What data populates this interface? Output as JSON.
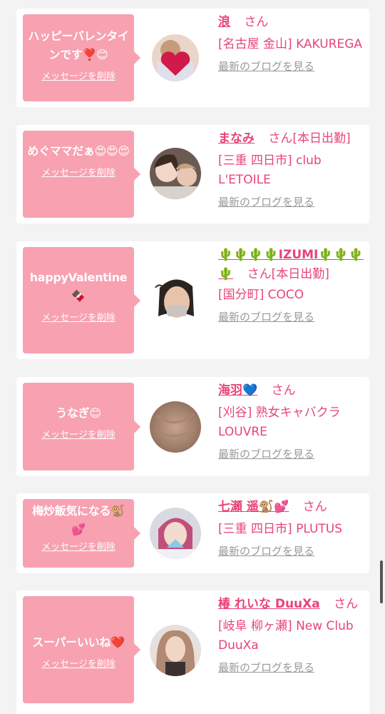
{
  "items": [
    {
      "message": "ハッピーバレンタインです❣️😊",
      "delete_label": "メッセージを削除",
      "name": "浪",
      "suffix": "さん",
      "location": "[名古屋 金山] KAKUREGA",
      "blog_label": "最新のブログを見る"
    },
    {
      "message": "めぐママだぁ😍😍😍",
      "delete_label": "メッセージを削除",
      "name": "まなみ",
      "suffix": "さん[本日出勤]",
      "location": "[三重 四日市] club L'ETOILE",
      "blog_label": "最新のブログを見る"
    },
    {
      "message": "happyValentine🍫",
      "delete_label": "メッセージを削除",
      "name": "🌵🌵🌵🌵IZUMI🌵🌵🌵🌵",
      "suffix": "さん[本日出勤]",
      "location": "[国分町] COCO",
      "blog_label": "最新のブログを見る"
    },
    {
      "message": "うなぎ😊",
      "delete_label": "メッセージを削除",
      "name": "海羽💙",
      "suffix": "さん",
      "location": "[刈谷] 熟女キャバクラ LOUVRE",
      "blog_label": "最新のブログを見る"
    },
    {
      "message": "梅炒飯気になる🐒💕",
      "delete_label": "メッセージを削除",
      "name": "七瀬 遥🐒💕",
      "suffix": "さん",
      "location": "[三重 四日市] PLUTUS",
      "blog_label": "最新のブログを見る"
    },
    {
      "message": "スーパーいいね❤️",
      "delete_label": "メッセージを削除",
      "name": "椿 れいな DuuXa",
      "suffix": "さん",
      "location": "[岐阜 柳ヶ瀬] New Club DuuXa",
      "blog_label": "最新のブログを見る"
    }
  ],
  "colors": {
    "accent": "#e84476",
    "bubble": "#f7a1b1",
    "muted": "#999999",
    "background": "#f3f3f3"
  }
}
